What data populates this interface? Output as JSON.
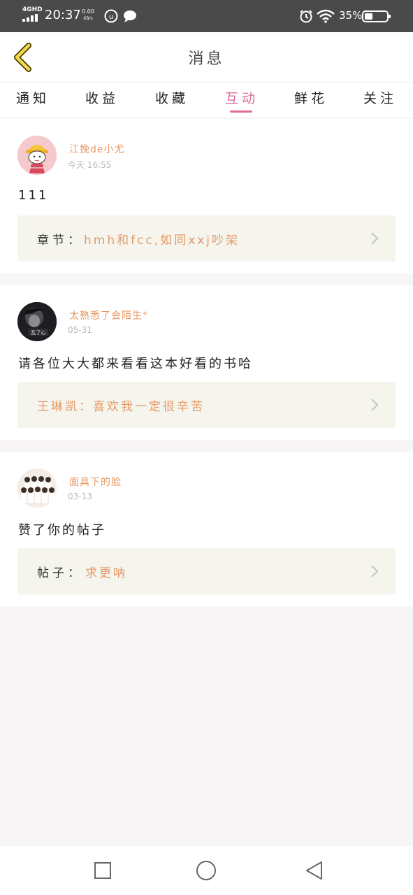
{
  "status_bar": {
    "network": "4GHD",
    "time": "20:37",
    "speed_value": "0.00",
    "speed_unit": "KB/s",
    "battery": "35%"
  },
  "header": {
    "back_icon": "chevron-left-icon",
    "title": "消息"
  },
  "tabs": [
    {
      "label": "通知"
    },
    {
      "label": "收益"
    },
    {
      "label": "收藏"
    },
    {
      "label": "互动",
      "active": true
    },
    {
      "label": "鲜花"
    },
    {
      "label": "关注"
    }
  ],
  "messages": [
    {
      "username": "江挽de小尤",
      "time": "今天 16:55",
      "content": "111",
      "ref_label": "章节：",
      "ref_value": "hmh和fcc,如同xxj吵架"
    },
    {
      "username": "太熟悉了会陌生°",
      "time": "05-31",
      "content": "请各位大大都来看看这本好看的书哈",
      "ref_label": "",
      "ref_value": "王琳凯：喜欢我一定很辛苦"
    },
    {
      "username": "面具下的脸",
      "time": "03-13",
      "content": "赞了你的帖子",
      "ref_label": "帖子：",
      "ref_value": "求更呐"
    }
  ],
  "colors": {
    "accent_pink": "#e06b9a",
    "username_orange": "#e59a66",
    "ref_background": "#f5f5ee",
    "status_bar": "#4a4a4a"
  }
}
